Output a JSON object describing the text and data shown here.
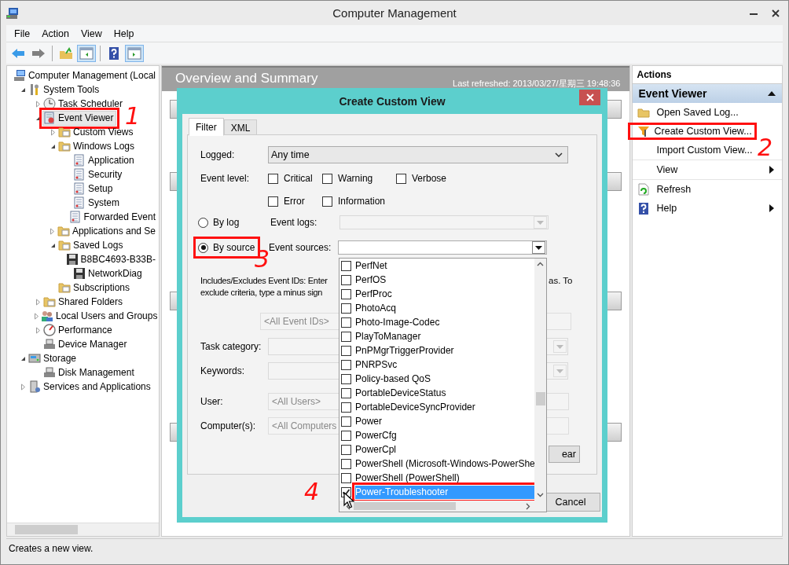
{
  "window": {
    "title": "Computer Management"
  },
  "menu": [
    "File",
    "Action",
    "View",
    "Help"
  ],
  "toolbar": [
    {
      "pressed": false
    },
    {
      "pressed": false
    },
    {
      "pressed": false
    },
    {
      "pressed": true
    },
    {
      "pressed": false
    },
    {
      "pressed": true
    }
  ],
  "tree": [
    {
      "label": "Computer Management (Local",
      "selected": false,
      "highlighted": false,
      "children": [
        {
          "label": "System Tools",
          "expanded": true,
          "selected": false,
          "highlighted": false,
          "children": [
            {
              "label": "Task Scheduler",
              "expanded": false,
              "selected": false,
              "highlighted": false
            },
            {
              "label": "Event Viewer",
              "expanded": true,
              "selected": true,
              "highlighted": true,
              "children": [
                {
                  "label": "Custom Views",
                  "expanded": false,
                  "selected": false,
                  "highlighted": false
                },
                {
                  "label": "Windows Logs",
                  "expanded": true,
                  "selected": false,
                  "highlighted": false,
                  "children": [
                    {
                      "label": "Application",
                      "selected": false,
                      "highlighted": false
                    },
                    {
                      "label": "Security",
                      "selected": false,
                      "highlighted": false
                    },
                    {
                      "label": "Setup",
                      "selected": false,
                      "highlighted": false
                    },
                    {
                      "label": "System",
                      "selected": false,
                      "highlighted": false
                    },
                    {
                      "label": "Forwarded Event",
                      "selected": false,
                      "highlighted": false
                    }
                  ]
                },
                {
                  "label": "Applications and Se",
                  "expanded": false,
                  "selected": false,
                  "highlighted": false
                },
                {
                  "label": "Saved Logs",
                  "expanded": true,
                  "selected": false,
                  "highlighted": false,
                  "children": [
                    {
                      "label": "B8BC4693-B33B-",
                      "selected": false,
                      "highlighted": false
                    },
                    {
                      "label": "NetworkDiag",
                      "selected": false,
                      "highlighted": false
                    }
                  ]
                },
                {
                  "label": "Subscriptions",
                  "selected": false,
                  "highlighted": false
                }
              ]
            },
            {
              "label": "Shared Folders",
              "expanded": false,
              "selected": false,
              "highlighted": false
            },
            {
              "label": "Local Users and Groups",
              "expanded": false,
              "selected": false,
              "highlighted": false
            },
            {
              "label": "Performance",
              "expanded": false,
              "selected": false,
              "highlighted": false
            },
            {
              "label": "Device Manager",
              "selected": false,
              "highlighted": false
            }
          ]
        },
        {
          "label": "Storage",
          "expanded": true,
          "selected": false,
          "highlighted": false,
          "children": [
            {
              "label": "Disk Management",
              "selected": false,
              "highlighted": false
            }
          ]
        },
        {
          "label": "Services and Applications",
          "expanded": false,
          "selected": false,
          "highlighted": false
        }
      ]
    }
  ],
  "center": {
    "title": "Overview and Summary",
    "last_refreshed": "Last refreshed: 2013/03/27/星期三 19:48:36"
  },
  "dialog": {
    "title": "Create Custom View",
    "tabs": [
      {
        "label": "Filter",
        "selected": true
      },
      {
        "label": "XML",
        "selected": false
      }
    ],
    "logged": {
      "label": "Logged:",
      "value": "Any time"
    },
    "event_level": {
      "label": "Event level:",
      "options": [
        {
          "label": "Critical",
          "checked": false
        },
        {
          "label": "Warning",
          "checked": false
        },
        {
          "label": "Verbose",
          "checked": false
        },
        {
          "label": "Error",
          "checked": false
        },
        {
          "label": "Information",
          "checked": false
        }
      ]
    },
    "scope": [
      {
        "label": "By log",
        "selected": false,
        "highlighted": false,
        "field_label": "Event logs:"
      },
      {
        "label": "By source",
        "selected": true,
        "highlighted": true,
        "field_label": "Event sources:"
      }
    ],
    "event_ids_text": [
      "Includes/Excludes Event IDs: Enter",
      "exclude criteria, type a minus sign"
    ],
    "event_ids_text_right": "as. To",
    "event_ids": {
      "placeholder": "<All Event IDs>"
    },
    "task_category": {
      "label": "Task category:"
    },
    "keywords": {
      "label": "Keywords:"
    },
    "user": {
      "label": "User:",
      "placeholder": "<All Users>"
    },
    "computers": {
      "label": "Computer(s):",
      "placeholder": "<All Computers"
    },
    "clear_button": "ear",
    "cancel_button": "Cancel",
    "sources_list": [
      {
        "label": "PerfNet",
        "checked": false,
        "selected": false,
        "highlighted": false
      },
      {
        "label": "PerfOS",
        "checked": false,
        "selected": false,
        "highlighted": false
      },
      {
        "label": "PerfProc",
        "checked": false,
        "selected": false,
        "highlighted": false
      },
      {
        "label": "PhotoAcq",
        "checked": false,
        "selected": false,
        "highlighted": false
      },
      {
        "label": "Photo-Image-Codec",
        "checked": false,
        "selected": false,
        "highlighted": false
      },
      {
        "label": "PlayToManager",
        "checked": false,
        "selected": false,
        "highlighted": false
      },
      {
        "label": "PnPMgrTriggerProvider",
        "checked": false,
        "selected": false,
        "highlighted": false
      },
      {
        "label": "PNRPSvc",
        "checked": false,
        "selected": false,
        "highlighted": false
      },
      {
        "label": "Policy-based QoS",
        "checked": false,
        "selected": false,
        "highlighted": false
      },
      {
        "label": "PortableDeviceStatus",
        "checked": false,
        "selected": false,
        "highlighted": false
      },
      {
        "label": "PortableDeviceSyncProvider",
        "checked": false,
        "selected": false,
        "highlighted": false
      },
      {
        "label": "Power",
        "checked": false,
        "selected": false,
        "highlighted": false
      },
      {
        "label": "PowerCfg",
        "checked": false,
        "selected": false,
        "highlighted": false
      },
      {
        "label": "PowerCpl",
        "checked": false,
        "selected": false,
        "highlighted": false
      },
      {
        "label": "PowerShell (Microsoft-Windows-PowerShe",
        "checked": false,
        "selected": false,
        "highlighted": false
      },
      {
        "label": "PowerShell (PowerShell)",
        "checked": false,
        "selected": false,
        "highlighted": false
      },
      {
        "label": "Power-Troubleshooter",
        "checked": true,
        "selected": true,
        "highlighted": true
      }
    ]
  },
  "actions": {
    "title": "Actions",
    "section": {
      "title": "Event Viewer",
      "expanded": true
    },
    "items": [
      {
        "label": "Open Saved Log...",
        "submenu": false,
        "highlighted": false
      },
      {
        "label": "Create Custom View...",
        "submenu": false,
        "highlighted": true
      },
      {
        "label": "Import Custom View...",
        "submenu": false,
        "highlighted": false
      },
      {
        "label": "View",
        "submenu": true,
        "highlighted": false
      },
      {
        "label": "Refresh",
        "submenu": false,
        "highlighted": false
      },
      {
        "label": "Help",
        "submenu": true,
        "highlighted": false
      }
    ]
  },
  "status_bar": "Creates a new view.",
  "annotations": [
    "1",
    "2",
    "3",
    "4"
  ]
}
